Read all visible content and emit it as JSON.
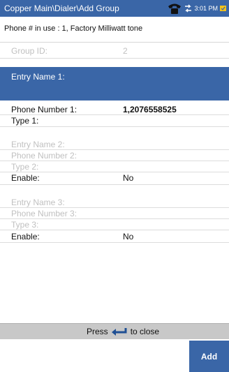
{
  "titlebar": {
    "title": "Copper Main\\Dialer\\Add Group",
    "time": "3:01 PM"
  },
  "info": {
    "phone_in_use": "Phone # in use : 1, Factory Milliwatt tone"
  },
  "fields": {
    "group_id_label": "Group ID:",
    "group_id_value": "2",
    "entry1_name_label": "Entry Name 1:",
    "entry1_phone_label": "Phone Number 1:",
    "entry1_phone_value": "1,2076558525",
    "entry1_type_label": "Type 1:",
    "entry2_name_label": "Entry Name 2:",
    "entry2_phone_label": "Phone Number 2:",
    "entry2_type_label": "Type 2:",
    "entry2_enable_label": "Enable:",
    "entry2_enable_value": "No",
    "entry3_name_label": "Entry Name 3:",
    "entry3_phone_label": "Phone Number 3:",
    "entry3_type_label": "Type 3:",
    "entry3_enable_label": "Enable:",
    "entry3_enable_value": "No"
  },
  "footer": {
    "press": "Press",
    "to_close": "to close"
  },
  "buttons": {
    "add": "Add"
  },
  "colors": {
    "accent": "#3a66a7",
    "disabled_text": "#c0c0c0"
  },
  "icons": [
    "phone-icon",
    "sync-arrows-icon",
    "battery-icon",
    "enter-key-icon"
  ]
}
